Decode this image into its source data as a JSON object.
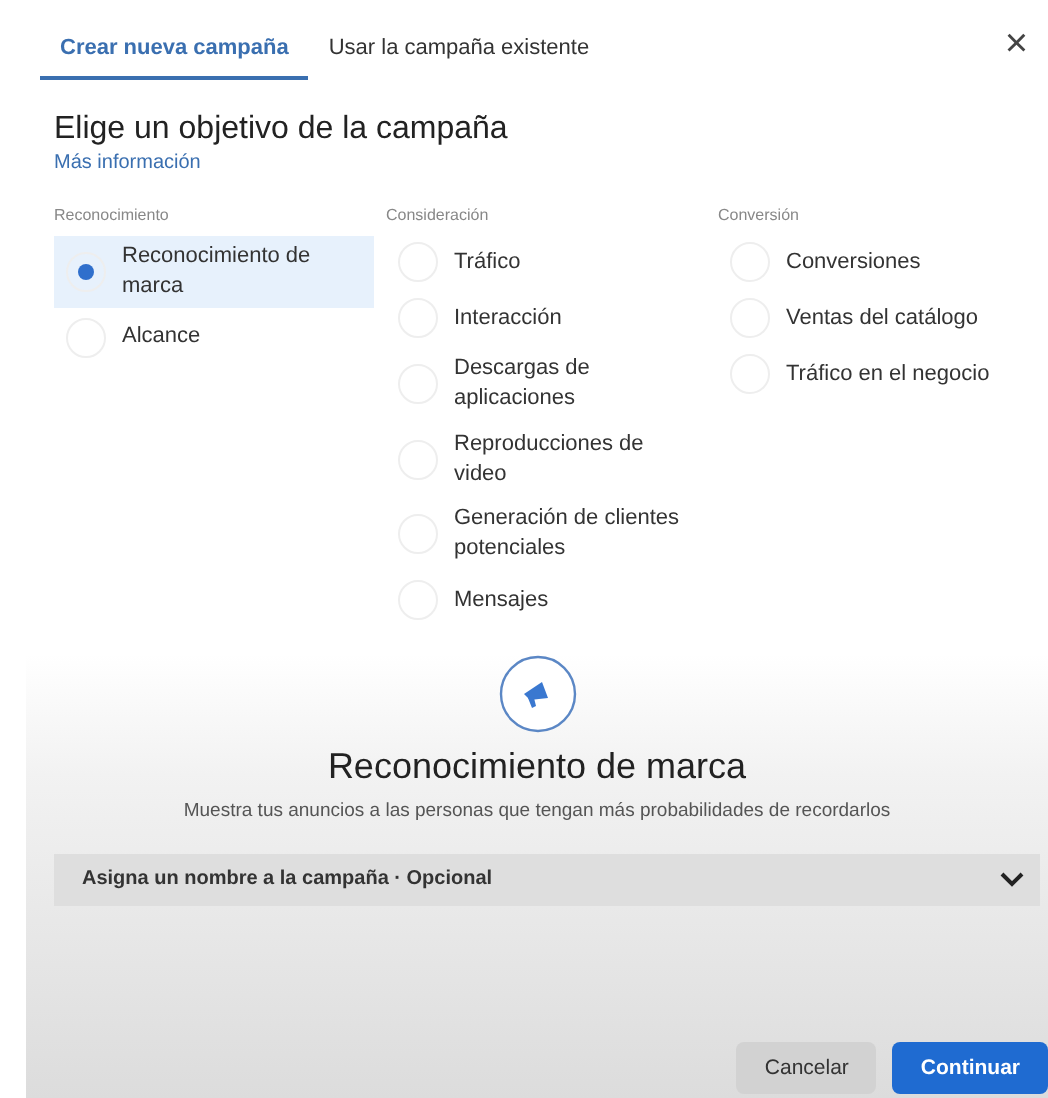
{
  "tabs": [
    {
      "label": "Crear nueva campaña",
      "selected": true
    },
    {
      "label": "Usar la campaña existente",
      "selected": false
    }
  ],
  "close": "×",
  "heading": "Elige un objetivo de la campaña",
  "link": "Más información",
  "groups": [
    {
      "label": "Reconocimiento",
      "options": [
        {
          "label": "Reconocimiento de marca",
          "selected": true
        },
        {
          "label": "Alcance",
          "selected": false
        }
      ]
    },
    {
      "label": "Consideración",
      "options": [
        {
          "label": "Tráfico",
          "selected": false
        },
        {
          "label": "Interacción",
          "selected": false
        },
        {
          "label": "Descargas de aplicaciones",
          "selected": false
        },
        {
          "label": "Reproducciones de video",
          "selected": false
        },
        {
          "label": "Generación de clientes potenciales",
          "selected": false
        },
        {
          "label": "Mensajes",
          "selected": false
        }
      ]
    },
    {
      "label": "Conversión",
      "options": [
        {
          "label": "Conversiones",
          "selected": false
        },
        {
          "label": "Ventas del catálogo",
          "selected": false
        },
        {
          "label": "Tráfico en el negocio",
          "selected": false
        }
      ]
    }
  ],
  "detail": {
    "title": "Reconocimiento de marca",
    "description": "Muestra tus anuncios a las personas que tengan más probabilidades de recordarlos"
  },
  "name_section": {
    "label": "Asigna un nombre a la campaña · Opcional",
    "expanded": false
  },
  "buttons": [
    {
      "label": "Cancelar",
      "kind": "secondary"
    },
    {
      "label": "Continuar",
      "kind": "primary"
    }
  ]
}
